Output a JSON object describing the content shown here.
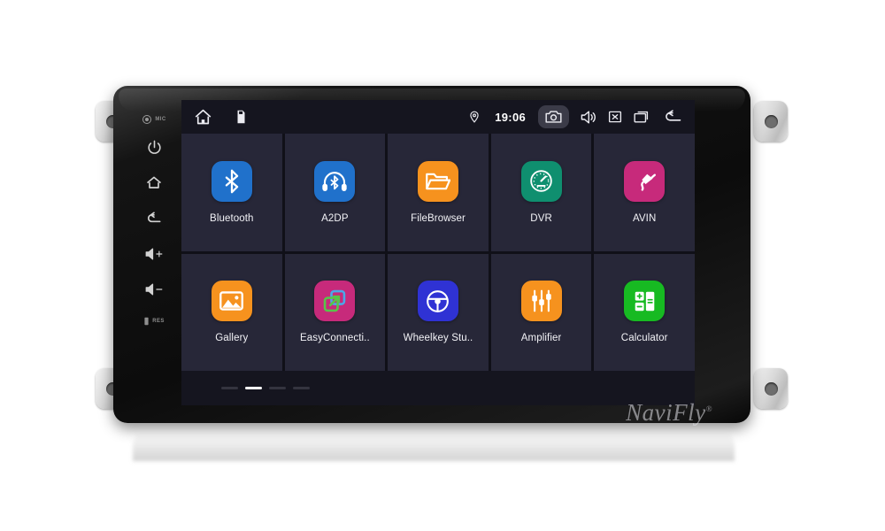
{
  "device": {
    "brand_watermark": "NaviFly",
    "brand_registered_mark": "®",
    "hardkeys": [
      {
        "name": "mic",
        "label": "MIC"
      },
      {
        "name": "power",
        "label": ""
      },
      {
        "name": "home",
        "label": ""
      },
      {
        "name": "back",
        "label": ""
      },
      {
        "name": "volume-up",
        "label": ""
      },
      {
        "name": "volume-down",
        "label": ""
      },
      {
        "name": "reset",
        "label": "RES"
      }
    ]
  },
  "status_bar": {
    "home_icon": "home-icon",
    "sd_icon": "sd-card-icon",
    "location_icon": "location-pin-icon",
    "clock": "19:06",
    "camera_icon": "camera-icon",
    "volume_icon": "volume-icon",
    "close_icon": "close-box-icon",
    "recents_icon": "recent-apps-icon",
    "back_icon": "back-arrow-icon"
  },
  "apps": [
    {
      "label": "Bluetooth",
      "icon": "bluetooth-icon",
      "bg": "#2071cb"
    },
    {
      "label": "A2DP",
      "icon": "headphones-icon",
      "bg": "#2071cb"
    },
    {
      "label": "FileBrowser",
      "icon": "folder-icon",
      "bg": "#f6921e"
    },
    {
      "label": "DVR",
      "icon": "speedometer-icon",
      "bg": "#0f8f6f"
    },
    {
      "label": "AVIN",
      "icon": "audio-jack-icon",
      "bg": "#c72a7b"
    },
    {
      "label": "Gallery",
      "icon": "photo-icon",
      "bg": "#f6921e"
    },
    {
      "label": "EasyConnecti..",
      "icon": "screen-share-icon",
      "bg": "#c72a7b"
    },
    {
      "label": "Wheelkey Stu..",
      "icon": "steering-wheel-icon",
      "bg": "#2f32d4"
    },
    {
      "label": "Amplifier",
      "icon": "equalizer-icon",
      "bg": "#f6921e"
    },
    {
      "label": "Calculator",
      "icon": "calculator-icon",
      "bg": "#17ba22"
    }
  ],
  "pager": {
    "total": 4,
    "active_index": 1
  },
  "colors": {
    "screen_bg": "#15151f",
    "tile_bg": "#272738",
    "grid_gap": "#101018",
    "status_text": "#ffffff",
    "camera_highlight": "#3b3b48",
    "pager_active": "#ffffff",
    "pager_inactive": "#34343f"
  }
}
